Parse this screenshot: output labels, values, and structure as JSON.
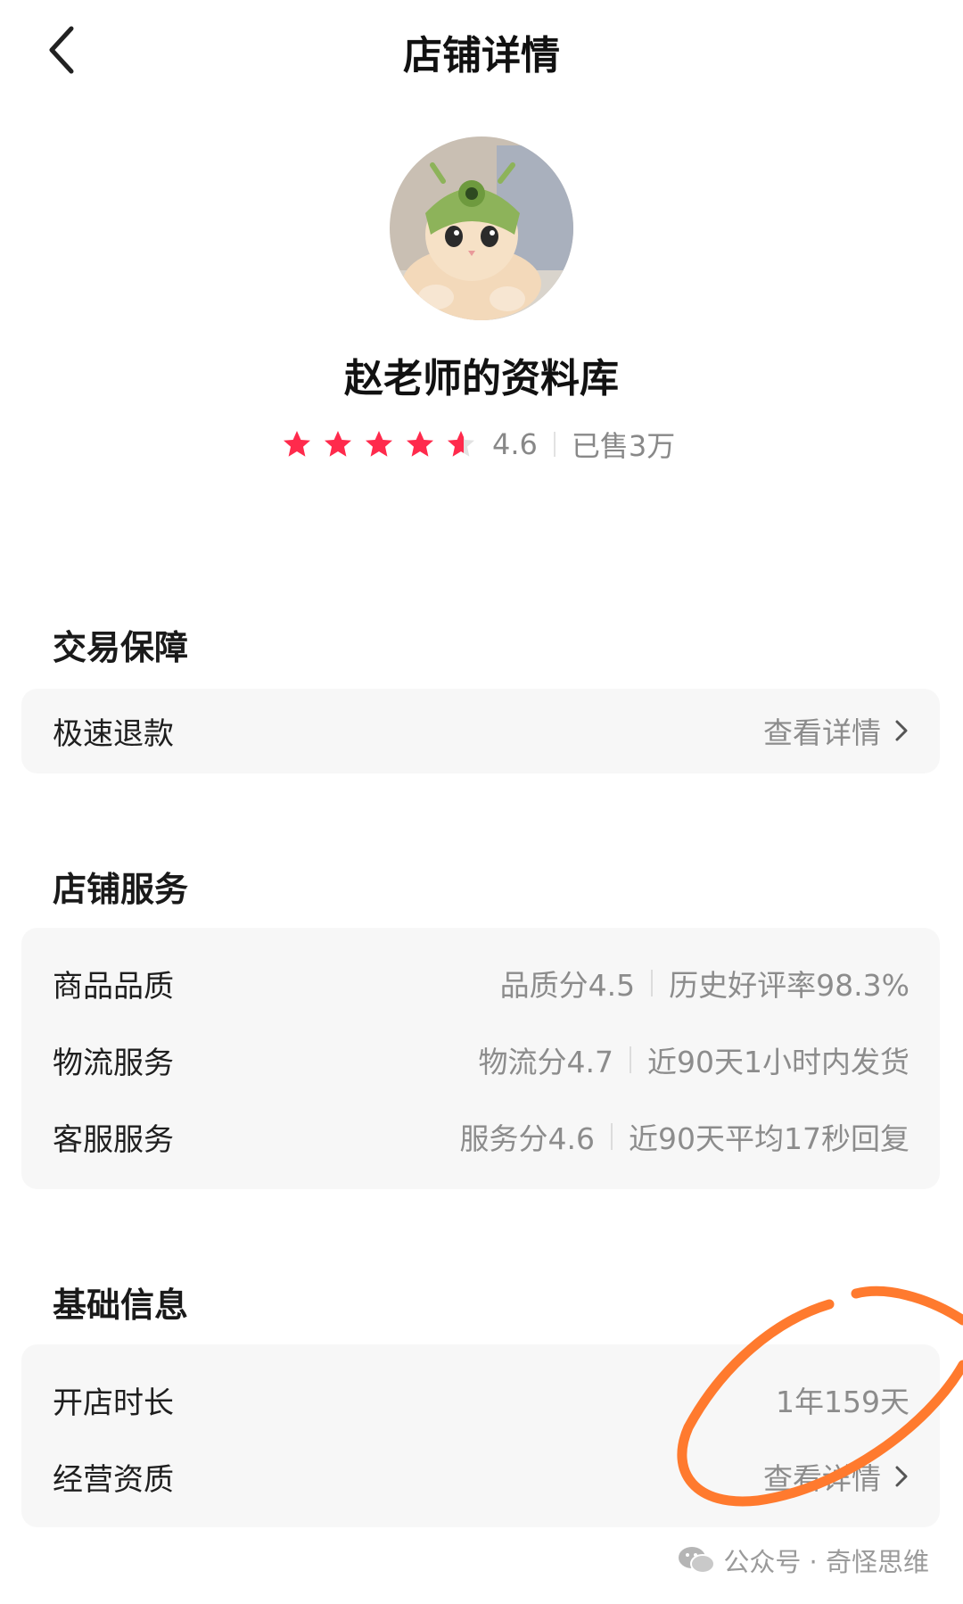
{
  "header": {
    "title": "店铺详情",
    "back_icon": "back-arrow-icon"
  },
  "shop": {
    "name": "赵老师的资料库",
    "rating": 4.6,
    "rating_text": "4.6",
    "sold_text": "已售3万",
    "star_color": "#ff2a4c"
  },
  "trade": {
    "title": "交易保障",
    "rows": [
      {
        "label": "极速退款",
        "action": "查看详情"
      }
    ]
  },
  "service": {
    "title": "店铺服务",
    "rows": [
      {
        "label": "商品品质",
        "score": "品质分4.5",
        "detail": "历史好评率98.3%"
      },
      {
        "label": "物流服务",
        "score": "物流分4.7",
        "detail": "近90天1小时内发货"
      },
      {
        "label": "客服服务",
        "score": "服务分4.6",
        "detail": "近90天平均17秒回复"
      }
    ]
  },
  "basic": {
    "title": "基础信息",
    "rows": [
      {
        "label": "开店时长",
        "value": "1年159天"
      },
      {
        "label": "经营资质",
        "action": "查看详情"
      }
    ]
  },
  "watermark": {
    "text": "公众号 · 奇怪思维",
    "icon": "wechat-icon"
  },
  "colors": {
    "background": "#ffffff",
    "card": "#f7f7f7",
    "annotation": "#ff7a2e",
    "muted_text": "#8c8c8c"
  }
}
